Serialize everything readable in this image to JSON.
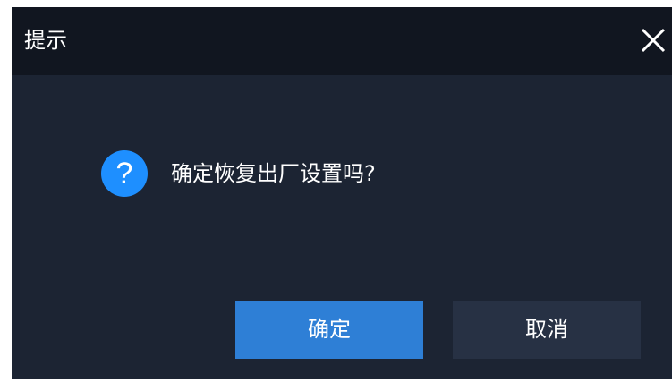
{
  "dialog": {
    "title": "提示",
    "close_icon": "close-icon",
    "message_icon": "question-icon",
    "message_icon_glyph": "?",
    "message": "确定恢复出厂设置吗?",
    "confirm_label": "确定",
    "cancel_label": "取消"
  },
  "colors": {
    "dialog_background": "#1c2433",
    "titlebar_background": "#111620",
    "icon_blue": "#1e8fff",
    "confirm_button": "#2e7fd6",
    "cancel_button": "#273144",
    "text": "#ffffff"
  }
}
